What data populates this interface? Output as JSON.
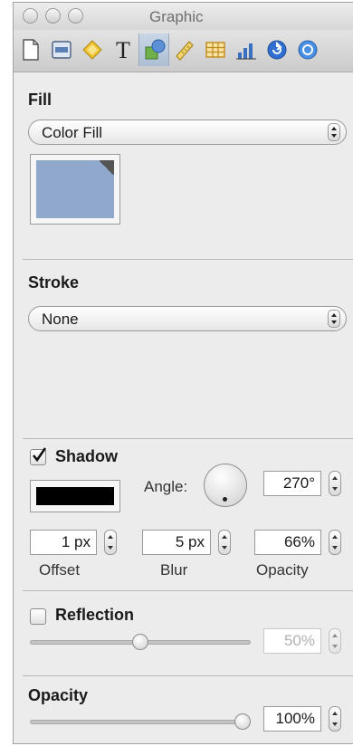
{
  "window": {
    "title": "Graphic"
  },
  "toolbar": {
    "tabs": [
      {
        "name": "document-icon"
      },
      {
        "name": "layout-icon"
      },
      {
        "name": "wrap-icon"
      },
      {
        "name": "text-icon"
      },
      {
        "name": "graphic-icon",
        "active": true
      },
      {
        "name": "metrics-icon"
      },
      {
        "name": "table-icon"
      },
      {
        "name": "chart-icon"
      },
      {
        "name": "hyperlink-icon"
      },
      {
        "name": "more-icon"
      }
    ]
  },
  "fill": {
    "title": "Fill",
    "type_value": "Color Fill",
    "color": "#8fa8cc"
  },
  "stroke": {
    "title": "Stroke",
    "type_value": "None"
  },
  "shadow": {
    "label": "Shadow",
    "checked": true,
    "color": "#000000",
    "angle_label": "Angle:",
    "angle_value": "270°",
    "offset_value": "1 px",
    "offset_label": "Offset",
    "blur_value": "5 px",
    "blur_label": "Blur",
    "opacity_value": "66%",
    "opacity_label": "Opacity"
  },
  "reflection": {
    "label": "Reflection",
    "checked": false,
    "value": "50%",
    "level": 0.5
  },
  "opacity": {
    "title": "Opacity",
    "value": "100%",
    "level": 1.0
  }
}
